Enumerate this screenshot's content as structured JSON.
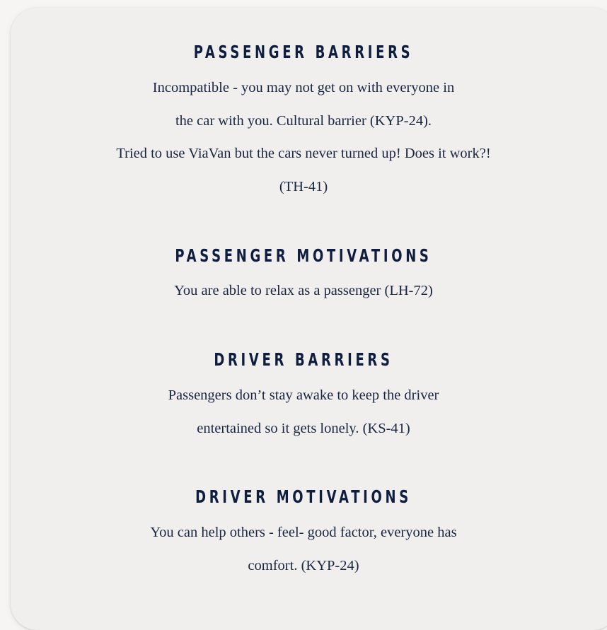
{
  "sections": [
    {
      "heading": "PASSENGER BARRIERS",
      "lines": [
        "Incompatible - you may not get on with everyone in",
        "the car with you. Cultural barrier (KYP-24).",
        "Tried to use ViaVan but the cars never turned up! Does it work?!",
        "(TH-41)"
      ]
    },
    {
      "heading": "PASSENGER MOTIVATIONS",
      "lines": [
        "You are able to relax as a passenger (LH-72)"
      ]
    },
    {
      "heading": "DRIVER BARRIERS",
      "lines": [
        "Passengers don’t stay awake to keep the driver",
        "entertained so it gets lonely. (KS-41)"
      ]
    },
    {
      "heading": "DRIVER MOTIVATIONS",
      "lines": [
        "You can help others - feel- good factor, everyone has",
        "comfort. (KYP-24)"
      ]
    }
  ]
}
